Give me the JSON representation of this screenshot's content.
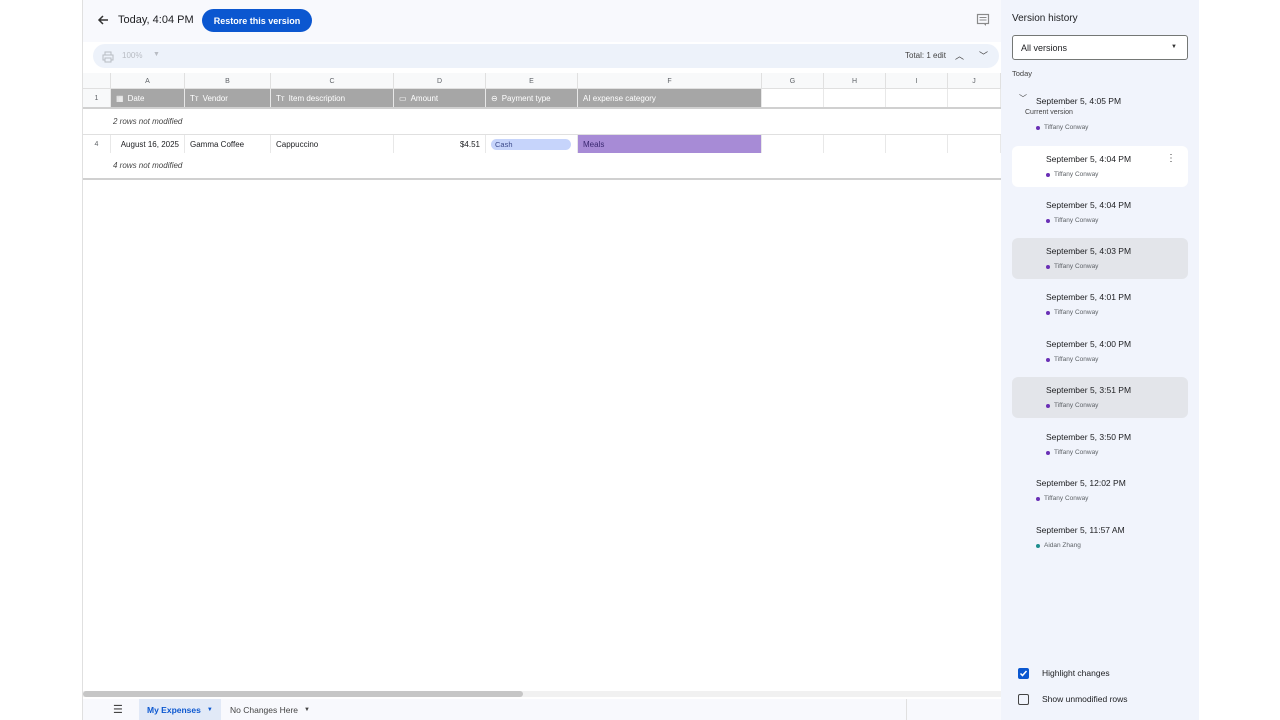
{
  "header": {
    "version_title": "Today, 4:04 PM",
    "restore_label": "Restore this version"
  },
  "toolbar": {
    "zoom": "100%",
    "total_edits": "Total: 1 edit"
  },
  "grid": {
    "columns": [
      "A",
      "B",
      "C",
      "D",
      "E",
      "F",
      "G",
      "H",
      "I",
      "J"
    ],
    "header_row": {
      "row_num": "1",
      "cells": [
        "Date",
        "Vendor",
        "Item description",
        "Amount",
        "Payment type",
        "AI expense category"
      ]
    },
    "not_modified_1": "2 rows not modified",
    "data_row": {
      "row_num": "4",
      "date": "August 16, 2025",
      "vendor": "Gamma Coffee",
      "item": "Cappuccino",
      "amount": "$4.51",
      "payment": "Cash",
      "category": "Meals"
    },
    "not_modified_2": "4 rows not modified"
  },
  "sheets": {
    "tabs": [
      "My Expenses",
      "No Changes Here"
    ]
  },
  "panel": {
    "title": "Version history",
    "filter": "All versions",
    "section": "Today",
    "current_label": "Current version",
    "versions": [
      {
        "time": "September 5, 4:05 PM",
        "author": "Tiffany Conway"
      },
      {
        "time": "September 5, 4:04 PM",
        "author": "Tiffany Conway"
      },
      {
        "time": "September 5, 4:04 PM",
        "author": "Tiffany Conway"
      },
      {
        "time": "September 5, 4:03 PM",
        "author": "Tiffany Conway"
      },
      {
        "time": "September 5, 4:01 PM",
        "author": "Tiffany Conway"
      },
      {
        "time": "September 5, 4:00 PM",
        "author": "Tiffany Conway"
      },
      {
        "time": "September 5, 3:51 PM",
        "author": "Tiffany Conway"
      },
      {
        "time": "September 5, 3:50 PM",
        "author": "Tiffany Conway"
      },
      {
        "time": "September 5, 12:02 PM",
        "author": "Tiffany Conway"
      },
      {
        "time": "September 5, 11:57 AM",
        "author": "Aidan Zhang"
      }
    ],
    "highlight_changes": "Highlight changes",
    "show_unmodified": "Show unmodified rows"
  },
  "colors": {
    "accent": "#0b57d0",
    "tiffany_dot": "#6a2fb5",
    "aidan_dot": "#1e8e8e",
    "cash_chip": "#c6d4fb",
    "meals_cell": "#a78bd6"
  }
}
